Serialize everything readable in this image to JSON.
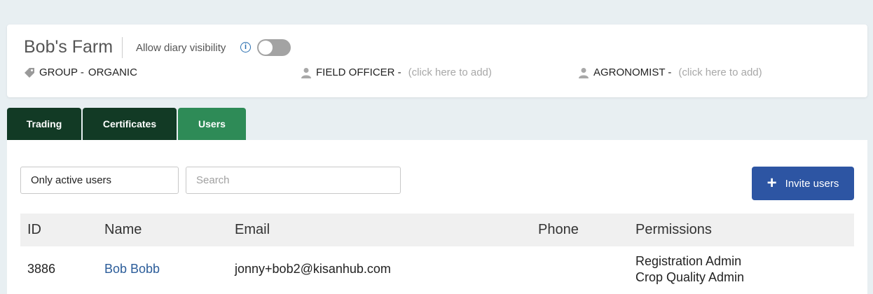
{
  "farm": {
    "name": "Bob's Farm",
    "diary_label": "Allow diary visibility",
    "info_icon": "info-icon",
    "toggle_on": false
  },
  "meta": {
    "group_label": "GROUP -",
    "group_value": "ORGANIC",
    "field_officer_label": "FIELD OFFICER -",
    "field_officer_placeholder": "(click here to add)",
    "agronomist_label": "AGRONOMIST -",
    "agronomist_placeholder": "(click here to add)"
  },
  "tabs": [
    {
      "label": "Trading",
      "active": false
    },
    {
      "label": "Certificates",
      "active": false
    },
    {
      "label": "Users",
      "active": true
    }
  ],
  "filters": {
    "status_value": "Only active users",
    "search_placeholder": "Search"
  },
  "actions": {
    "invite_label": "Invite users"
  },
  "table": {
    "columns": [
      "ID",
      "Name",
      "Email",
      "Phone",
      "Permissions"
    ],
    "rows": [
      {
        "id": "3886",
        "name": "Bob Bobb",
        "email": "jonny+bob2@kisanhub.com",
        "phone": "",
        "permissions": [
          "Registration Admin",
          "Crop Quality Admin"
        ]
      }
    ]
  },
  "colors": {
    "tab_dark": "#123a25",
    "tab_active": "#2e8b57",
    "invite_button": "#2d55a3",
    "link": "#2c5d9a"
  }
}
